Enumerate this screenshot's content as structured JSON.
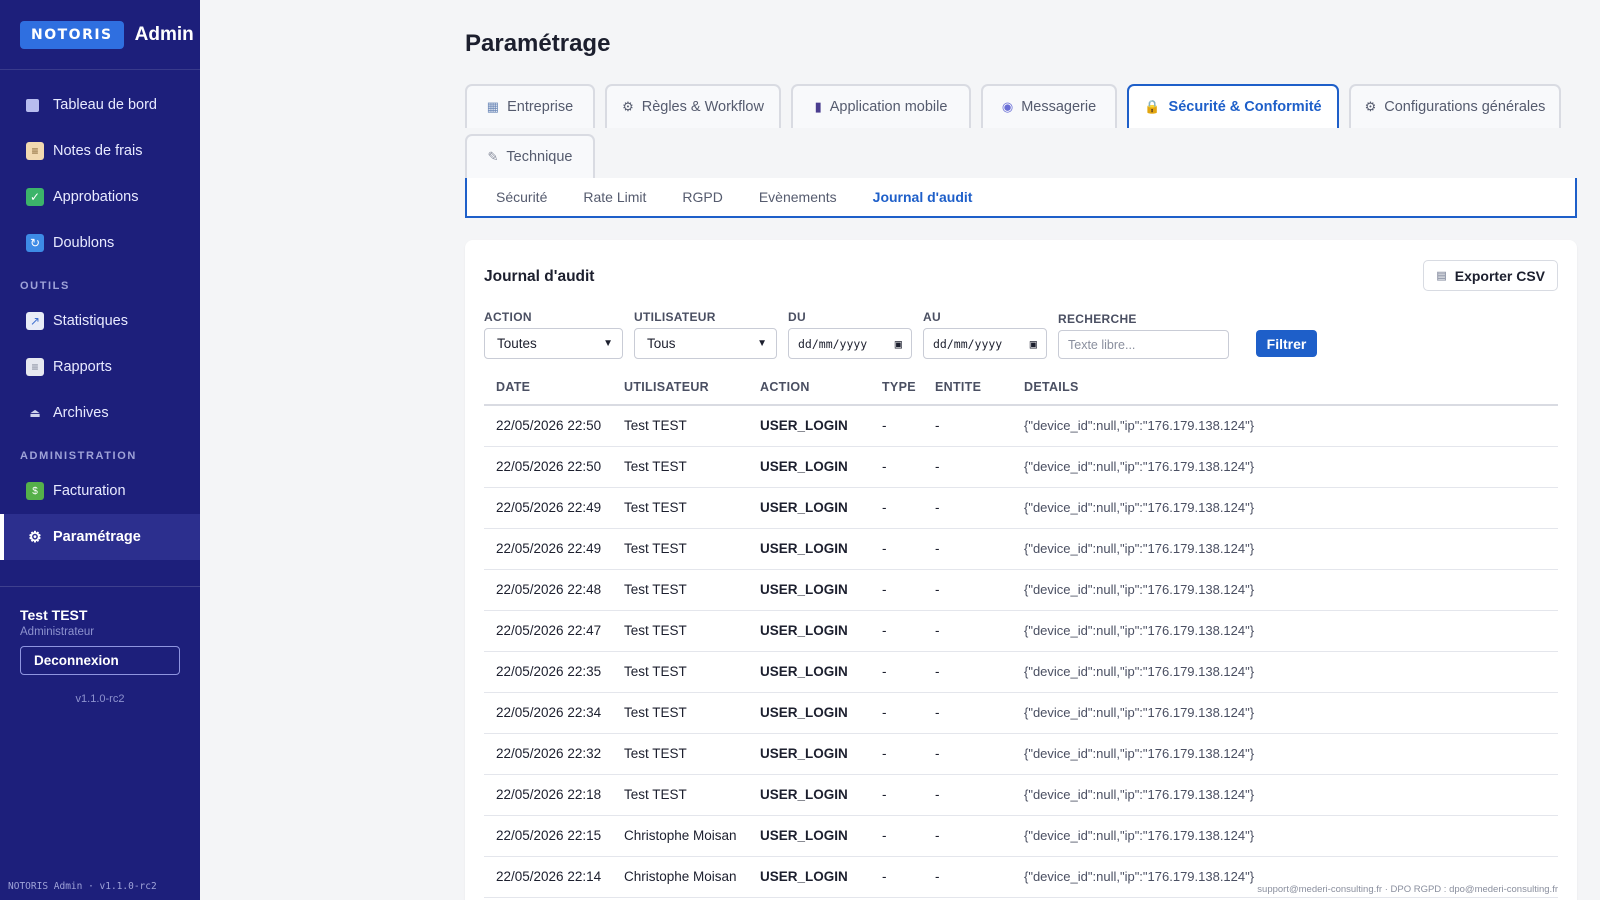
{
  "brand": {
    "badge": "NOTORIS",
    "admin": "Admin"
  },
  "sidebar": {
    "items": [
      {
        "label": "Tableau de bord",
        "icon": "dashboard-icon"
      },
      {
        "label": "Notes de frais",
        "icon": "receipt-icon"
      },
      {
        "label": "Approbations",
        "icon": "check-icon"
      },
      {
        "label": "Doublons",
        "icon": "duplicate-icon"
      }
    ],
    "section_outils": "OUTILS",
    "outils": [
      {
        "label": "Statistiques",
        "icon": "chart-icon"
      },
      {
        "label": "Rapports",
        "icon": "document-icon"
      },
      {
        "label": "Archives",
        "icon": "archive-icon"
      }
    ],
    "section_admin": "ADMINISTRATION",
    "admin": [
      {
        "label": "Facturation",
        "icon": "money-icon"
      },
      {
        "label": "Paramétrage",
        "icon": "gear-icon"
      }
    ],
    "user": {
      "name": "Test TEST",
      "role": "Administrateur"
    },
    "logout": "Deconnexion",
    "version": "v1.1.0-rc2",
    "footer_version": "NOTORIS Admin · v1.1.0-rc2"
  },
  "page": {
    "title": "Paramétrage"
  },
  "tabs": [
    {
      "label": "Entreprise",
      "icon": "building-icon"
    },
    {
      "label": "Règles & Workflow",
      "icon": "gear-icon"
    },
    {
      "label": "Application mobile",
      "icon": "phone-icon"
    },
    {
      "label": "Messagerie",
      "icon": "mail-icon"
    },
    {
      "label": "Sécurité & Conformité",
      "icon": "lock-icon"
    },
    {
      "label": "Configurations générales",
      "icon": "gear-icon"
    },
    {
      "label": "Technique",
      "icon": "wrench-icon"
    }
  ],
  "subtabs": [
    "Sécurité",
    "Rate Limit",
    "RGPD",
    "Evènements",
    "Journal d'audit"
  ],
  "audit": {
    "title": "Journal d'audit",
    "export_label": "Exporter CSV",
    "filters": {
      "action_label": "ACTION",
      "action_value": "Toutes",
      "user_label": "UTILISATEUR",
      "user_value": "Tous",
      "du_label": "DU",
      "du_value": "dd/mm/yyyy",
      "au_label": "AU",
      "au_value": "dd/mm/yyyy",
      "search_label": "RECHERCHE",
      "search_placeholder": "Texte libre...",
      "submit": "Filtrer"
    },
    "columns": [
      "DATE",
      "UTILISATEUR",
      "ACTION",
      "TYPE",
      "ENTITE",
      "DETAILS"
    ],
    "rows": [
      [
        "22/05/2026 22:50",
        "Test TEST",
        "USER_LOGIN",
        "-",
        "-",
        "{\"device_id\":null,\"ip\":\"176.179.138.124\"}"
      ],
      [
        "22/05/2026 22:50",
        "Test TEST",
        "USER_LOGIN",
        "-",
        "-",
        "{\"device_id\":null,\"ip\":\"176.179.138.124\"}"
      ],
      [
        "22/05/2026 22:49",
        "Test TEST",
        "USER_LOGIN",
        "-",
        "-",
        "{\"device_id\":null,\"ip\":\"176.179.138.124\"}"
      ],
      [
        "22/05/2026 22:49",
        "Test TEST",
        "USER_LOGIN",
        "-",
        "-",
        "{\"device_id\":null,\"ip\":\"176.179.138.124\"}"
      ],
      [
        "22/05/2026 22:48",
        "Test TEST",
        "USER_LOGIN",
        "-",
        "-",
        "{\"device_id\":null,\"ip\":\"176.179.138.124\"}"
      ],
      [
        "22/05/2026 22:47",
        "Test TEST",
        "USER_LOGIN",
        "-",
        "-",
        "{\"device_id\":null,\"ip\":\"176.179.138.124\"}"
      ],
      [
        "22/05/2026 22:35",
        "Test TEST",
        "USER_LOGIN",
        "-",
        "-",
        "{\"device_id\":null,\"ip\":\"176.179.138.124\"}"
      ],
      [
        "22/05/2026 22:34",
        "Test TEST",
        "USER_LOGIN",
        "-",
        "-",
        "{\"device_id\":null,\"ip\":\"176.179.138.124\"}"
      ],
      [
        "22/05/2026 22:32",
        "Test TEST",
        "USER_LOGIN",
        "-",
        "-",
        "{\"device_id\":null,\"ip\":\"176.179.138.124\"}"
      ],
      [
        "22/05/2026 22:18",
        "Test TEST",
        "USER_LOGIN",
        "-",
        "-",
        "{\"device_id\":null,\"ip\":\"176.179.138.124\"}"
      ],
      [
        "22/05/2026 22:15",
        "Christophe Moisan",
        "USER_LOGIN",
        "-",
        "-",
        "{\"device_id\":null,\"ip\":\"176.179.138.124\"}"
      ],
      [
        "22/05/2026 22:14",
        "Christophe Moisan",
        "USER_LOGIN",
        "-",
        "-",
        "{\"device_id\":null,\"ip\":\"176.179.138.124\"}"
      ]
    ]
  },
  "footer": {
    "contact": "support@mederi-consulting.fr · DPO RGPD : dpo@mederi-consulting.fr"
  },
  "colors": {
    "sidebar": "#1d1f7b",
    "accent": "#1e5fc9",
    "brand_badge": "#2f6fe0"
  }
}
